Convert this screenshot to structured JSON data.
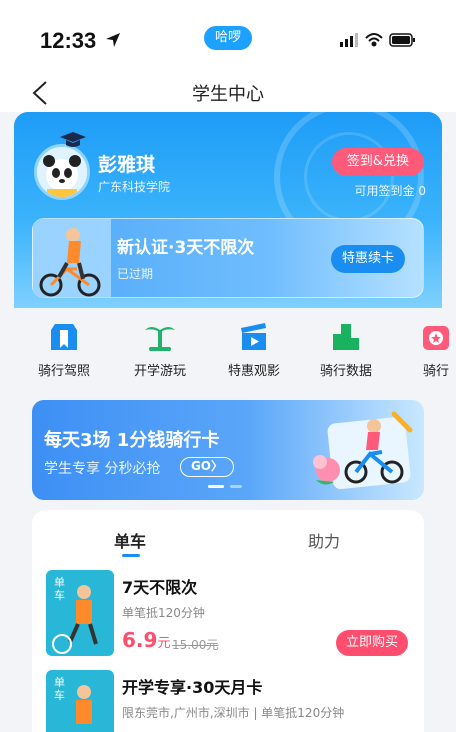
{
  "status_bar": {
    "time": "12:33",
    "app_pill": "哈啰"
  },
  "nav": {
    "title": "学生中心"
  },
  "profile": {
    "name": "彭雅琪",
    "school": "广东科技学院",
    "checkin_label": "签到&兑换",
    "points_label": "可用签到金 0"
  },
  "membership": {
    "title": "新认证·3天不限次",
    "status": "已过期",
    "renew_label": "特惠续卡"
  },
  "shortcuts": [
    {
      "label": "骑行驾照",
      "icon": "license-icon",
      "color": "#1a8ef0"
    },
    {
      "label": "开学游玩",
      "icon": "palm-tree-icon",
      "color": "#1fb36b"
    },
    {
      "label": "特惠观影",
      "icon": "clapperboard-icon",
      "color": "#1a8ef0"
    },
    {
      "label": "骑行数据",
      "icon": "data-chart-icon",
      "color": "#19b35f"
    },
    {
      "label": "骑行",
      "icon": "gift-icon",
      "color": "#ff5a7a"
    }
  ],
  "promo": {
    "title": "每天3场 1分钱骑行卡",
    "subtitle": "学生专享 分秒必抢",
    "go_label": "GO"
  },
  "products": {
    "tabs": [
      {
        "label": "单车",
        "active": true
      },
      {
        "label": "助力",
        "active": false
      }
    ],
    "items": [
      {
        "tag": "单车",
        "name": "7天不限次",
        "desc": "单笔抵120分钟",
        "price": "6.9",
        "price_unit": "元",
        "original_price": "15.00元",
        "buy_label": "立即购买"
      },
      {
        "tag": "单车",
        "name": "开学专享·30天月卡",
        "desc": "限东莞市,广州市,深圳市 | 单笔抵120分钟"
      }
    ]
  }
}
